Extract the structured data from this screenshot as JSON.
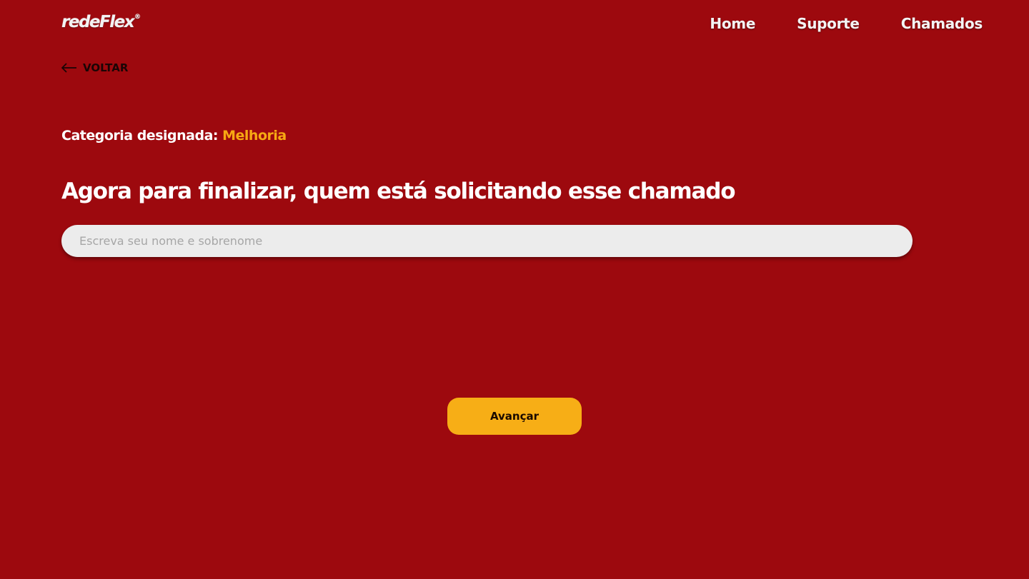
{
  "header": {
    "logo_text": "redeFlex",
    "logo_mark": "®",
    "nav": {
      "home": "Home",
      "support": "Suporte",
      "tickets": "Chamados"
    }
  },
  "back": {
    "icon": "arrow-left-icon",
    "label": "VOLTAR"
  },
  "category": {
    "label": "Categoria designada:",
    "value": "Melhoria"
  },
  "main": {
    "heading": "Agora para finalizar, quem está solicitando esse chamado",
    "name_input": {
      "value": "",
      "placeholder": "Escreva seu nome e sobrenome"
    },
    "next_button_label": "Avançar"
  },
  "colors": {
    "background": "#9d090e",
    "accent": "#f7ae16",
    "input_background": "#ececec"
  }
}
